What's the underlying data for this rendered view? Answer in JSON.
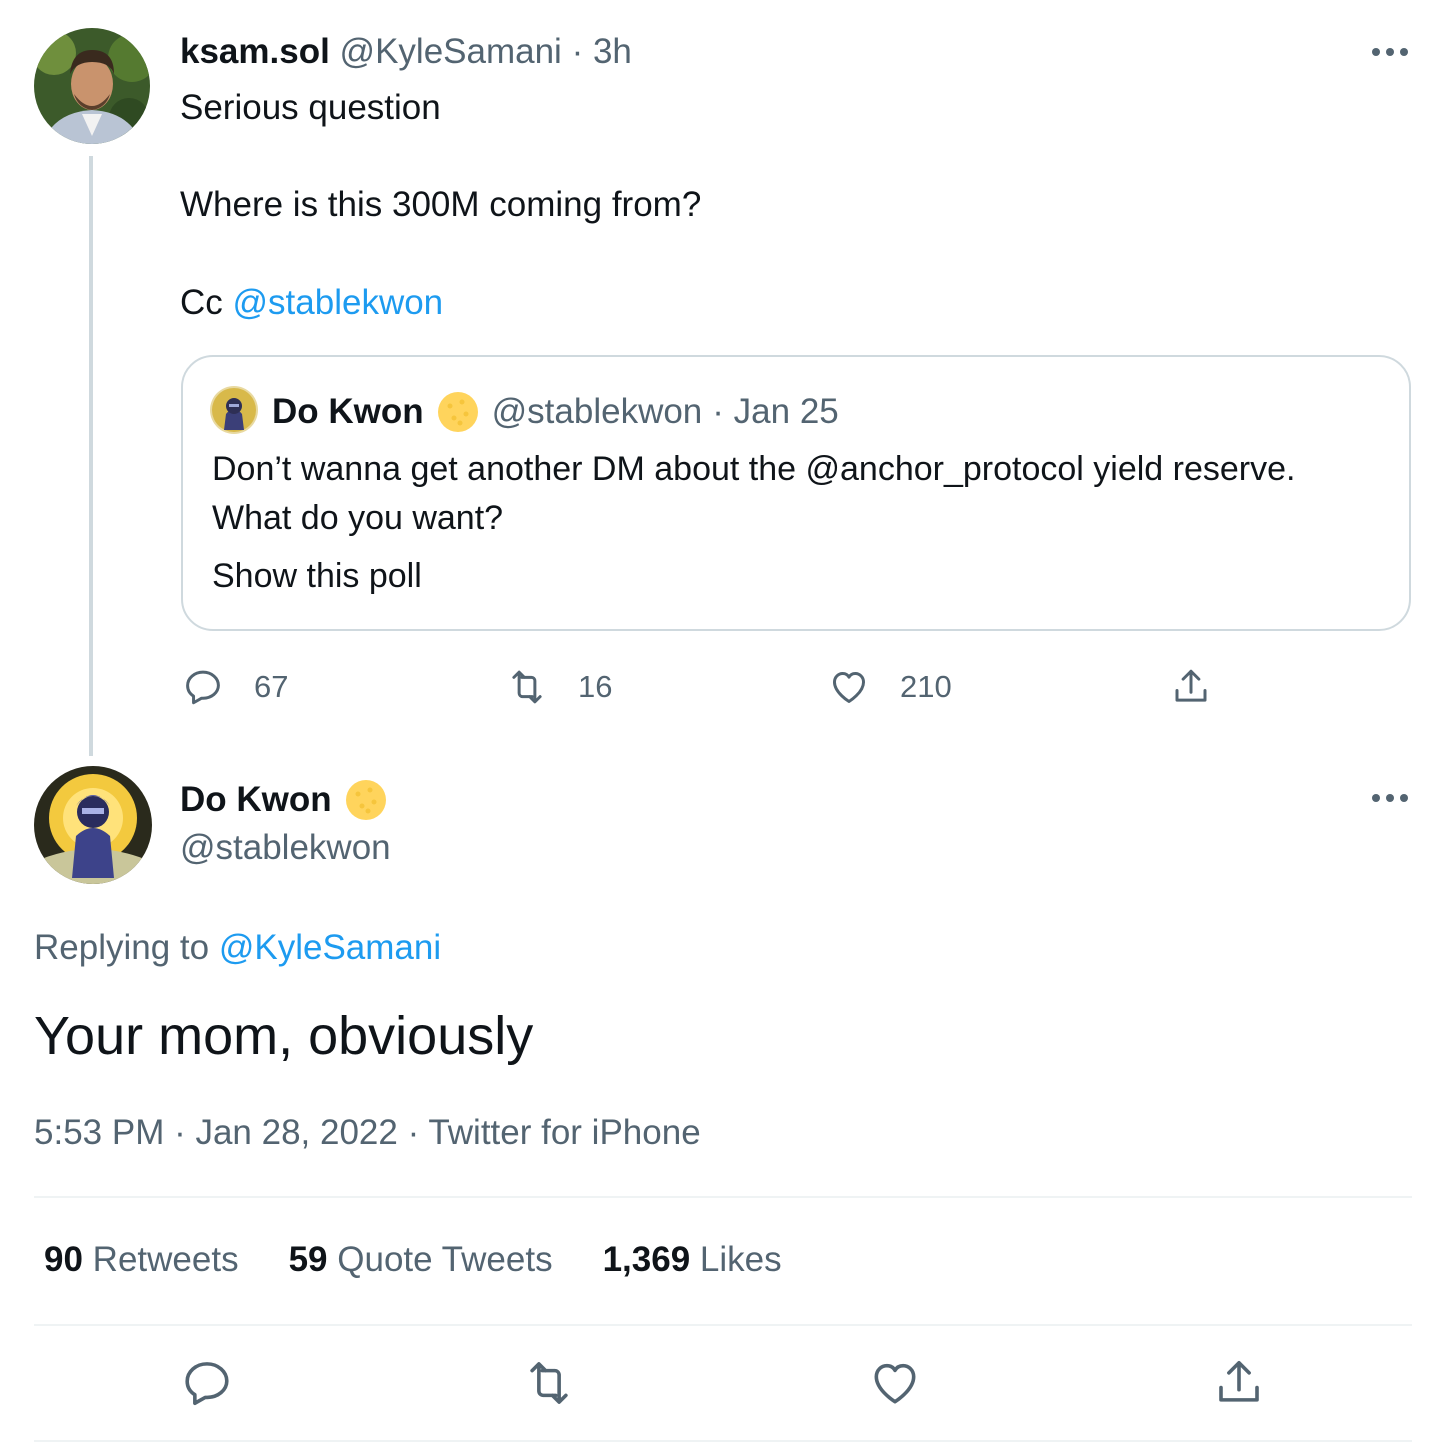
{
  "parent_tweet": {
    "display_name": "ksam.sol",
    "handle": "@KyleSamani",
    "time": "· 3h",
    "line1": "Serious question",
    "line2": "Where is this 300M coming from?",
    "cc_prefix": "Cc",
    "cc_mention": "@stablekwon",
    "quote": {
      "display_name": "Do Kwon",
      "handle": "@stablekwon",
      "date": "· Jan 25",
      "text_line1": "Don’t wanna get another DM about the @anchor_protocol yield reserve.",
      "text_line2": "What do you want?",
      "poll_link": "Show this poll"
    },
    "actions": {
      "replies": "67",
      "retweets": "16",
      "likes": "210"
    }
  },
  "reply_tweet": {
    "display_name": "Do Kwon",
    "handle": "@stablekwon",
    "replying_prefix": "Replying to",
    "replying_to": "@KyleSamani",
    "text": "Your mom, obviously",
    "timestamp": "5:53 PM · Jan 28, 2022 · Twitter for iPhone",
    "stats": {
      "retweets_count": "90",
      "retweets_label": "Retweets",
      "quotes_count": "59",
      "quotes_label": "Quote Tweets",
      "likes_count": "1,369",
      "likes_label": "Likes"
    }
  },
  "colors": {
    "link": "#1d9bf0",
    "muted": "#536471",
    "verified": "#ffd45c"
  }
}
